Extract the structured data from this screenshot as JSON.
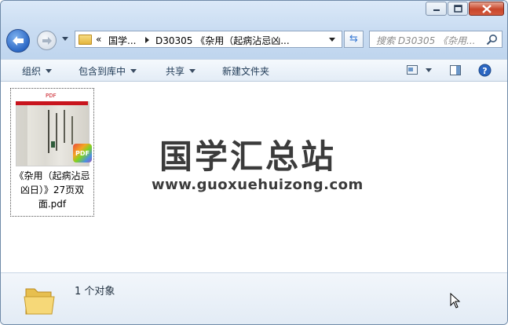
{
  "window": {
    "controls": {
      "minimize_icon": "minimize-icon",
      "maximize_icon": "maximize-icon",
      "close_icon": "close-icon"
    }
  },
  "address_bar": {
    "overflow": "«",
    "segment_1": "国学...",
    "segment_2": "D30305 《杂用（起病沾忌凶..."
  },
  "search": {
    "placeholder": "搜索 D30305 《杂用..."
  },
  "toolbar": {
    "organize": "组织",
    "include_in_library": "包含到库中",
    "share": "共享",
    "new_folder": "新建文件夹"
  },
  "file": {
    "thumb_tag": "PDF",
    "badge": "PDF",
    "name": "《杂用（起病沾忌凶日）》27页双面.pdf"
  },
  "watermark": {
    "title": "国学汇总站",
    "url": "www.guoxuehuizong.com"
  },
  "details": {
    "count_text": "1 个对象"
  },
  "colors": {
    "accent": "#2c68c5",
    "close": "#c8462b",
    "text": "#1e3955"
  }
}
